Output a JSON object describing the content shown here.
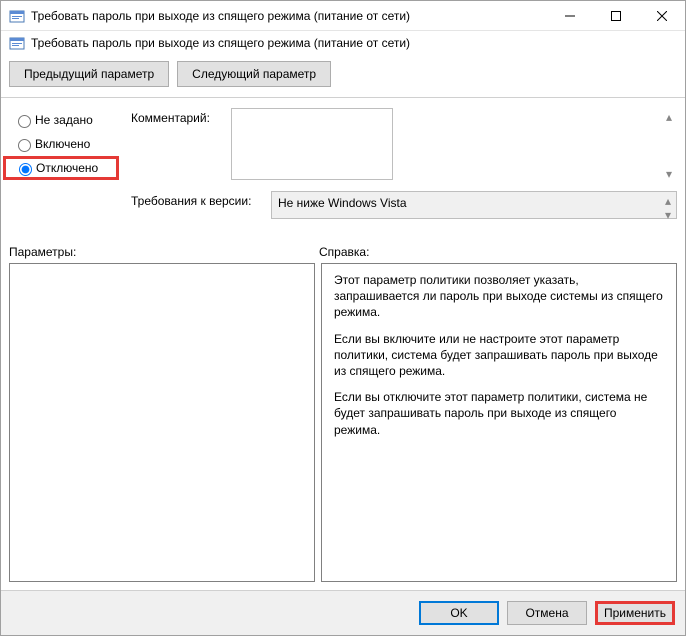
{
  "window": {
    "title": "Требовать пароль при выходе из спящего режима (питание от сети)"
  },
  "header": {
    "text": "Требовать пароль при выходе из спящего режима (питание от сети)"
  },
  "nav": {
    "prev": "Предыдущий параметр",
    "next": "Следующий параметр"
  },
  "radios": {
    "not_configured": "Не задано",
    "enabled": "Включено",
    "disabled": "Отключено",
    "selected": "disabled"
  },
  "fields": {
    "comment_label": "Комментарий:",
    "comment_value": "",
    "requirements_label": "Требования к версии:",
    "requirements_value": "Не ниже Windows Vista"
  },
  "panels": {
    "options_label": "Параметры:",
    "help_label": "Справка:",
    "help_p1": "Этот параметр политики позволяет указать, запрашивается ли пароль при выходе системы из спящего режима.",
    "help_p2": "Если вы включите или не настроите этот параметр политики, система будет запрашивать пароль при выходе из спящего режима.",
    "help_p3": "Если вы отключите этот параметр политики, система не будет запрашивать пароль при выходе из спящего режима."
  },
  "footer": {
    "ok": "OK",
    "cancel": "Отмена",
    "apply": "Применить"
  }
}
